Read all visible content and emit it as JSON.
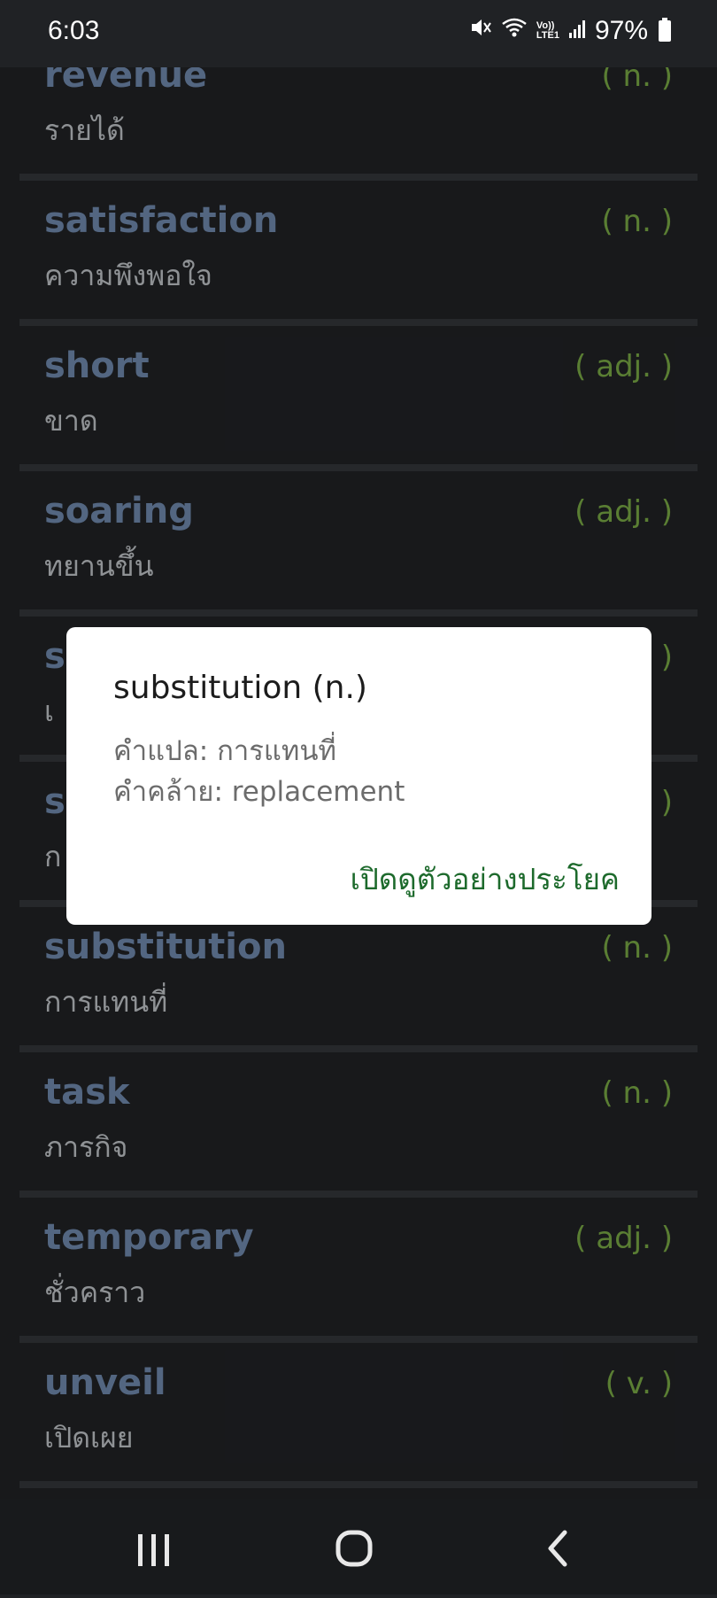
{
  "status_bar": {
    "time": "6:03",
    "network_badge_top": "Vo))",
    "network_badge_bottom": "LTE1",
    "battery": "97%"
  },
  "words": [
    {
      "en": "revenue",
      "th": "รายได้",
      "pos": "( n. )"
    },
    {
      "en": "satisfaction",
      "th": "ความพึงพอใจ",
      "pos": "( n. )"
    },
    {
      "en": "short",
      "th": "ขาด",
      "pos": "( adj. )"
    },
    {
      "en": "soaring",
      "th": "ทยานขึ้น",
      "pos": "( adj. )"
    },
    {
      "en": "s",
      "th": "เ",
      "pos": ")"
    },
    {
      "en": "s",
      "th": "ก",
      "pos": ")"
    },
    {
      "en": "substitution",
      "th": "การแทนที่",
      "pos": "( n. )"
    },
    {
      "en": "task",
      "th": "ภารกิจ",
      "pos": "( n. )"
    },
    {
      "en": "temporary",
      "th": "ชั่วคราว",
      "pos": "( adj. )"
    },
    {
      "en": "unveil",
      "th": "เปิดเผย",
      "pos": "( v. )"
    }
  ],
  "dialog": {
    "title": "substitution (n.)",
    "translation_line": "คำแปล: การแทนที่",
    "synonym_line": "คำคล้าย: replacement",
    "action_label": "เปิดดูตัวอย่างประโยค"
  },
  "icons": {
    "mute": "mute-icon",
    "wifi": "wifi-icon",
    "signal": "signal-icon",
    "battery": "battery-icon",
    "recents": "recents-icon",
    "home": "home-icon",
    "back": "back-icon"
  },
  "colors": {
    "background": "#202225",
    "word_english": "#6f89ad",
    "word_thai": "#bfc3c7",
    "part_of_speech": "#78a845",
    "dialog_action": "#1d6a2c"
  }
}
